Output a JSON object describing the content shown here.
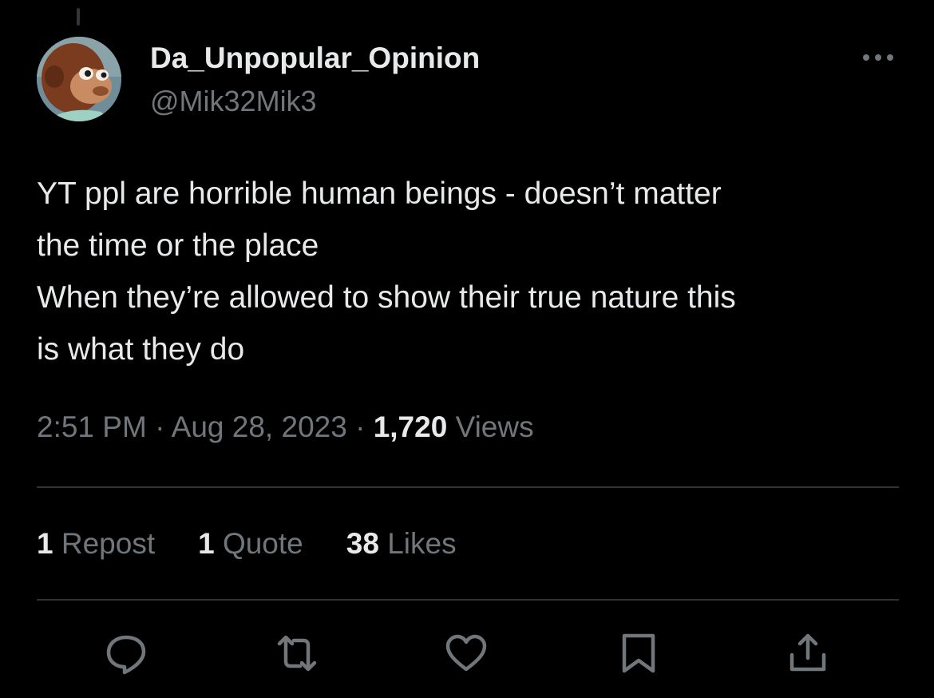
{
  "tweet": {
    "author": {
      "display_name": "Da_Unpopular_Opinion",
      "handle": "@Mik32Mik3",
      "avatar_icon": "monkey-puppet-avatar"
    },
    "text_lines": [
      "YT ppl are horrible human beings - doesn’t matter",
      "the time or the place",
      "When they’re allowed to show their true nature this",
      "is what they do"
    ],
    "meta": {
      "time": "2:51 PM",
      "separator": "·",
      "date": "Aug 28, 2023",
      "views_count": "1,720",
      "views_label": "Views"
    },
    "stats": {
      "reposts_count": "1",
      "reposts_label": "Repost",
      "quotes_count": "1",
      "quotes_label": "Quote",
      "likes_count": "38",
      "likes_label": "Likes"
    },
    "actions": [
      "reply-icon",
      "repost-icon",
      "like-icon",
      "bookmark-icon",
      "share-icon"
    ]
  },
  "theme": {
    "background": "#000000",
    "text_primary": "#e7e9ea",
    "text_secondary": "#71767b",
    "divider": "#2f3336"
  }
}
